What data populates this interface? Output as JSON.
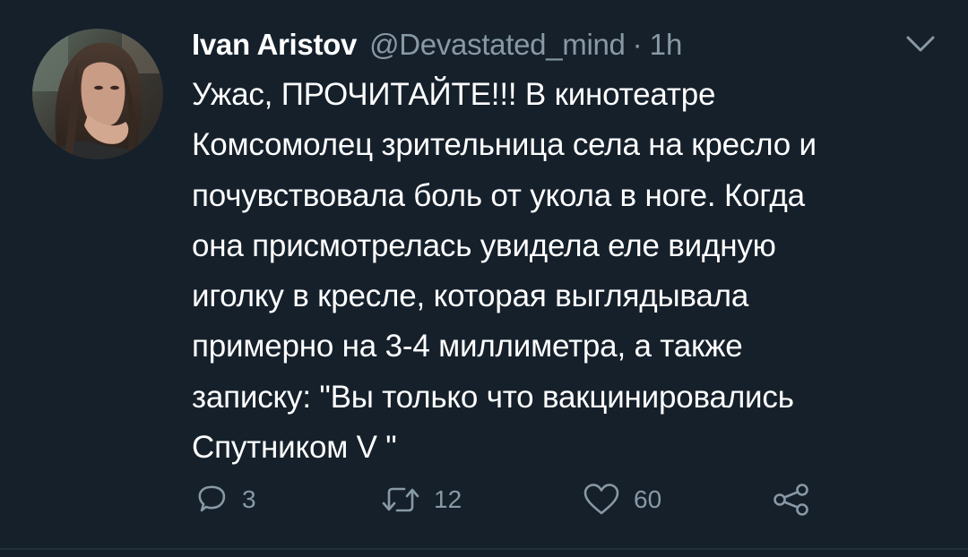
{
  "tweet": {
    "display_name": "Ivan Aristov",
    "handle": "@Devastated_mind",
    "separator": "·",
    "time": "1h",
    "text": "Ужас, ПРОЧИТАЙТЕ!!! В кинотеатре\nКомсомолец зрительница села на кресло и\nпочувствовала боль от укола в ноге. Когда\nона присмотрелась увидела еле видную\nиголку в кресле, которая выглядывала\nпримерно на 3-4 миллиметра, а также\nзаписку: \"Вы только что вакцинировались\nСпутником V \"",
    "actions": {
      "reply_count": "3",
      "retweet_count": "12",
      "like_count": "60"
    }
  },
  "icons": {
    "reply": "reply-icon",
    "retweet": "retweet-icon",
    "like": "heart-icon",
    "share": "share-icon",
    "menu": "chevron-down-icon"
  },
  "colors": {
    "background": "#15202b",
    "primary_text": "#ffffff",
    "secondary_text": "#8899a6"
  }
}
